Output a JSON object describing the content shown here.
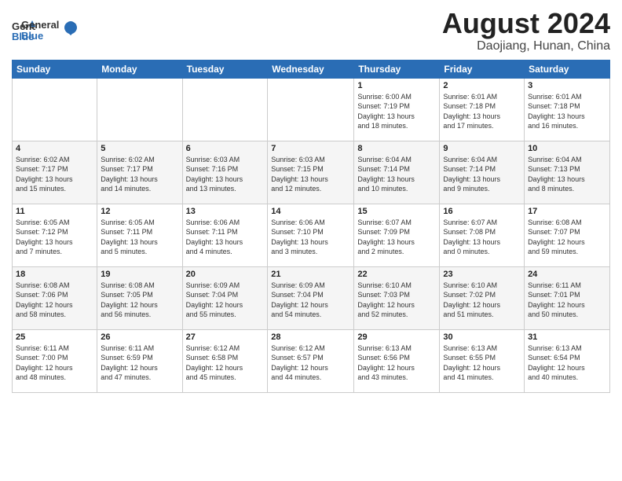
{
  "header": {
    "logo_general": "General",
    "logo_blue": "Blue",
    "main_title": "August 2024",
    "subtitle": "Daojiang, Hunan, China"
  },
  "weekdays": [
    "Sunday",
    "Monday",
    "Tuesday",
    "Wednesday",
    "Thursday",
    "Friday",
    "Saturday"
  ],
  "weeks": [
    [
      {
        "num": "",
        "info": ""
      },
      {
        "num": "",
        "info": ""
      },
      {
        "num": "",
        "info": ""
      },
      {
        "num": "",
        "info": ""
      },
      {
        "num": "1",
        "info": "Sunrise: 6:00 AM\nSunset: 7:19 PM\nDaylight: 13 hours\nand 18 minutes."
      },
      {
        "num": "2",
        "info": "Sunrise: 6:01 AM\nSunset: 7:18 PM\nDaylight: 13 hours\nand 17 minutes."
      },
      {
        "num": "3",
        "info": "Sunrise: 6:01 AM\nSunset: 7:18 PM\nDaylight: 13 hours\nand 16 minutes."
      }
    ],
    [
      {
        "num": "4",
        "info": "Sunrise: 6:02 AM\nSunset: 7:17 PM\nDaylight: 13 hours\nand 15 minutes."
      },
      {
        "num": "5",
        "info": "Sunrise: 6:02 AM\nSunset: 7:17 PM\nDaylight: 13 hours\nand 14 minutes."
      },
      {
        "num": "6",
        "info": "Sunrise: 6:03 AM\nSunset: 7:16 PM\nDaylight: 13 hours\nand 13 minutes."
      },
      {
        "num": "7",
        "info": "Sunrise: 6:03 AM\nSunset: 7:15 PM\nDaylight: 13 hours\nand 12 minutes."
      },
      {
        "num": "8",
        "info": "Sunrise: 6:04 AM\nSunset: 7:14 PM\nDaylight: 13 hours\nand 10 minutes."
      },
      {
        "num": "9",
        "info": "Sunrise: 6:04 AM\nSunset: 7:14 PM\nDaylight: 13 hours\nand 9 minutes."
      },
      {
        "num": "10",
        "info": "Sunrise: 6:04 AM\nSunset: 7:13 PM\nDaylight: 13 hours\nand 8 minutes."
      }
    ],
    [
      {
        "num": "11",
        "info": "Sunrise: 6:05 AM\nSunset: 7:12 PM\nDaylight: 13 hours\nand 7 minutes."
      },
      {
        "num": "12",
        "info": "Sunrise: 6:05 AM\nSunset: 7:11 PM\nDaylight: 13 hours\nand 5 minutes."
      },
      {
        "num": "13",
        "info": "Sunrise: 6:06 AM\nSunset: 7:11 PM\nDaylight: 13 hours\nand 4 minutes."
      },
      {
        "num": "14",
        "info": "Sunrise: 6:06 AM\nSunset: 7:10 PM\nDaylight: 13 hours\nand 3 minutes."
      },
      {
        "num": "15",
        "info": "Sunrise: 6:07 AM\nSunset: 7:09 PM\nDaylight: 13 hours\nand 2 minutes."
      },
      {
        "num": "16",
        "info": "Sunrise: 6:07 AM\nSunset: 7:08 PM\nDaylight: 13 hours\nand 0 minutes."
      },
      {
        "num": "17",
        "info": "Sunrise: 6:08 AM\nSunset: 7:07 PM\nDaylight: 12 hours\nand 59 minutes."
      }
    ],
    [
      {
        "num": "18",
        "info": "Sunrise: 6:08 AM\nSunset: 7:06 PM\nDaylight: 12 hours\nand 58 minutes."
      },
      {
        "num": "19",
        "info": "Sunrise: 6:08 AM\nSunset: 7:05 PM\nDaylight: 12 hours\nand 56 minutes."
      },
      {
        "num": "20",
        "info": "Sunrise: 6:09 AM\nSunset: 7:04 PM\nDaylight: 12 hours\nand 55 minutes."
      },
      {
        "num": "21",
        "info": "Sunrise: 6:09 AM\nSunset: 7:04 PM\nDaylight: 12 hours\nand 54 minutes."
      },
      {
        "num": "22",
        "info": "Sunrise: 6:10 AM\nSunset: 7:03 PM\nDaylight: 12 hours\nand 52 minutes."
      },
      {
        "num": "23",
        "info": "Sunrise: 6:10 AM\nSunset: 7:02 PM\nDaylight: 12 hours\nand 51 minutes."
      },
      {
        "num": "24",
        "info": "Sunrise: 6:11 AM\nSunset: 7:01 PM\nDaylight: 12 hours\nand 50 minutes."
      }
    ],
    [
      {
        "num": "25",
        "info": "Sunrise: 6:11 AM\nSunset: 7:00 PM\nDaylight: 12 hours\nand 48 minutes."
      },
      {
        "num": "26",
        "info": "Sunrise: 6:11 AM\nSunset: 6:59 PM\nDaylight: 12 hours\nand 47 minutes."
      },
      {
        "num": "27",
        "info": "Sunrise: 6:12 AM\nSunset: 6:58 PM\nDaylight: 12 hours\nand 45 minutes."
      },
      {
        "num": "28",
        "info": "Sunrise: 6:12 AM\nSunset: 6:57 PM\nDaylight: 12 hours\nand 44 minutes."
      },
      {
        "num": "29",
        "info": "Sunrise: 6:13 AM\nSunset: 6:56 PM\nDaylight: 12 hours\nand 43 minutes."
      },
      {
        "num": "30",
        "info": "Sunrise: 6:13 AM\nSunset: 6:55 PM\nDaylight: 12 hours\nand 41 minutes."
      },
      {
        "num": "31",
        "info": "Sunrise: 6:13 AM\nSunset: 6:54 PM\nDaylight: 12 hours\nand 40 minutes."
      }
    ]
  ]
}
